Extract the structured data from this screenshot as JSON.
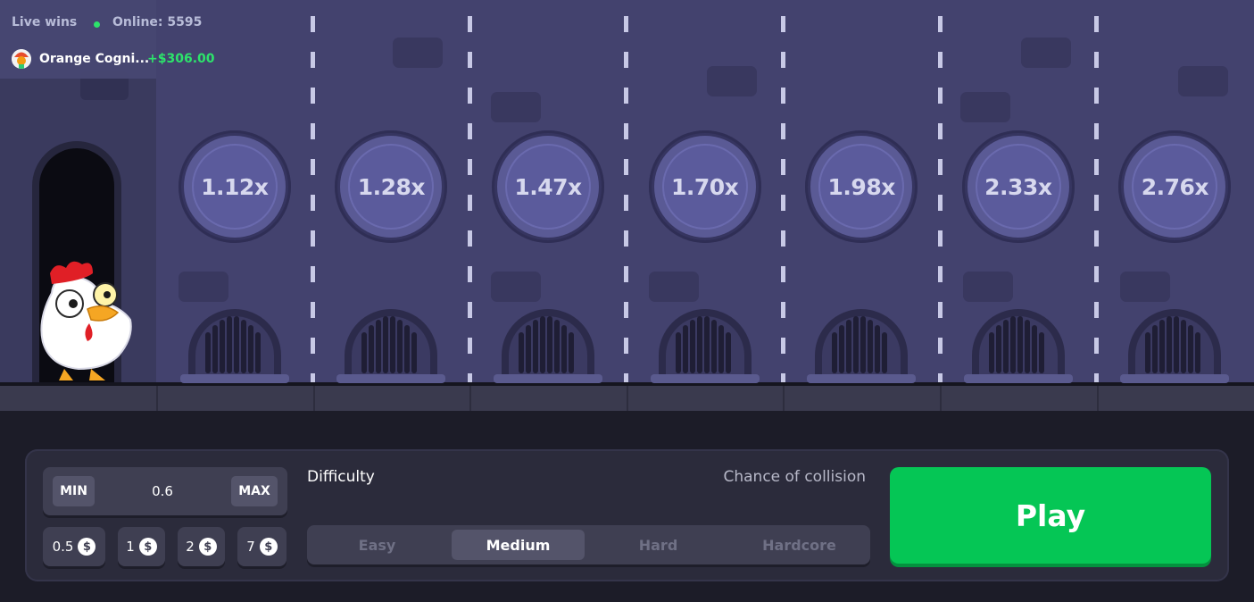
{
  "live_wins": {
    "title": "Live wins",
    "online_label": "Online: 5595",
    "latest": {
      "name": "Orange Cogni...",
      "amount": "+$306.00"
    }
  },
  "multipliers": [
    "1.12x",
    "1.28x",
    "1.47x",
    "1.70x",
    "1.98x",
    "2.33x",
    "2.76x"
  ],
  "bet": {
    "min_label": "MIN",
    "max_label": "MAX",
    "value": "0.6",
    "quick_amounts": [
      "0.5",
      "1",
      "2",
      "7"
    ],
    "currency_icon": "dollar-coin-icon",
    "currency_symbol": "$"
  },
  "difficulty": {
    "label": "Difficulty",
    "chance_label": "Chance of collision",
    "options": [
      "Easy",
      "Medium",
      "Hard",
      "Hardcore"
    ],
    "selected": "Medium"
  },
  "play_label": "Play",
  "colors": {
    "play": "#05c655",
    "online_dot": "#2de36b",
    "win_amount": "#2de36b",
    "scene": "#43426e",
    "panel": "#2b2b3b"
  }
}
